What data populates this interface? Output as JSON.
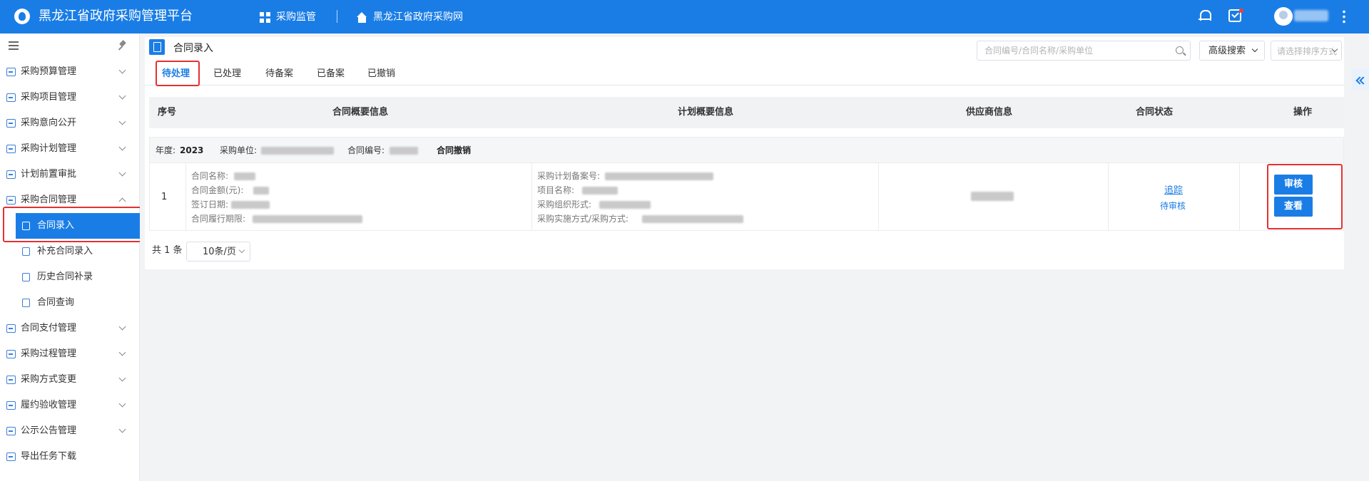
{
  "app": {
    "title": "黑龙江省政府采购管理平台",
    "nav": [
      "采购监管",
      "黑龙江省政府采购网"
    ]
  },
  "sidebar": {
    "items": [
      {
        "label": "采购预算管理"
      },
      {
        "label": "采购项目管理"
      },
      {
        "label": "采购意向公开"
      },
      {
        "label": "采购计划管理"
      },
      {
        "label": "计划前置审批"
      },
      {
        "label": "采购合同管理",
        "expanded": true,
        "children": [
          "合同录入",
          "补充合同录入",
          "历史合同补录",
          "合同查询"
        ],
        "active_child": "合同录入"
      },
      {
        "label": "合同支付管理"
      },
      {
        "label": "采购过程管理"
      },
      {
        "label": "采购方式变更"
      },
      {
        "label": "履约验收管理"
      },
      {
        "label": "公示公告管理"
      },
      {
        "label": "导出任务下载"
      }
    ]
  },
  "page": {
    "title": "合同录入",
    "search_placeholder": "合同编号/合同名称/采购单位",
    "advanced_search": "高级搜索",
    "sort_placeholder": "请选择排序方式",
    "tabs": [
      "待处理",
      "已处理",
      "待备案",
      "已备案",
      "已撤销"
    ],
    "active_tab": "待处理"
  },
  "table": {
    "headers": [
      "序号",
      "合同概要信息",
      "计划概要信息",
      "供应商信息",
      "合同状态",
      "操作"
    ],
    "group": {
      "year_label": "年度:",
      "year": "2023",
      "unit_label": "采购单位:",
      "code_label": "合同编号:",
      "revoke": "合同撤销"
    },
    "row": {
      "index": "1",
      "contract_fields": [
        "合同名称:",
        "合同金额(元):",
        "签订日期:",
        "合同履行期限:"
      ],
      "plan_fields": [
        "采购计划备案号:",
        "项目名称:",
        "采购组织形式:",
        "采购实施方式/采购方式:"
      ],
      "status_link": "追踪",
      "status": "待审核",
      "actions": [
        "审核",
        "查看"
      ]
    }
  },
  "pagination": {
    "total": "共 1 条",
    "page_size": "10条/页"
  },
  "colors": {
    "primary": "#1a7de6",
    "highlight": "#e53030"
  }
}
